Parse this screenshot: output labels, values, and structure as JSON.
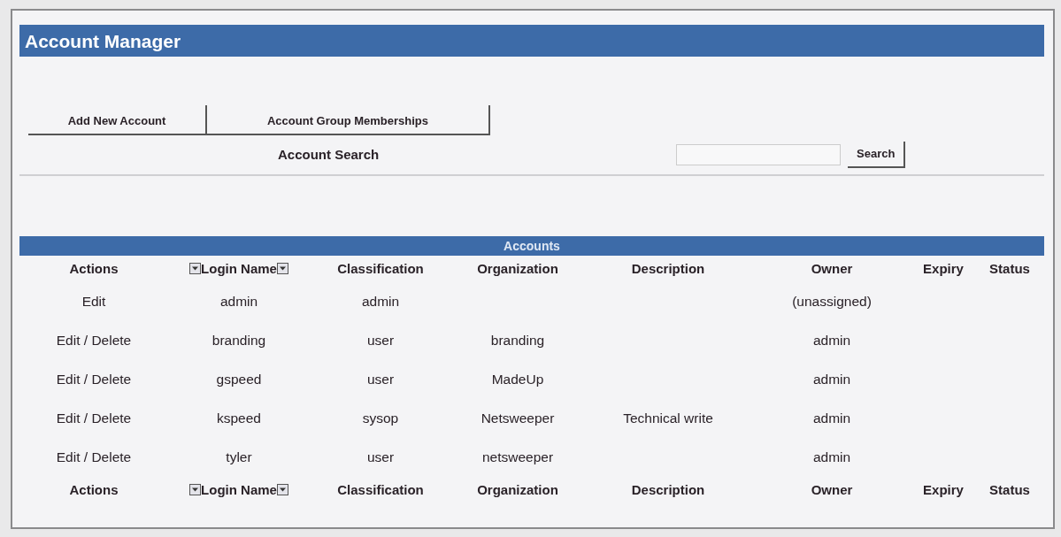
{
  "title": "Account Manager",
  "tabs": [
    {
      "label": "Add New Account"
    },
    {
      "label": "Account Group Memberships"
    }
  ],
  "search": {
    "label": "Account Search",
    "button": "Search"
  },
  "accounts": {
    "title": "Accounts",
    "columns": [
      {
        "label": "Actions",
        "sortable": false
      },
      {
        "label": "Login Name",
        "sortable": true
      },
      {
        "label": "Classification",
        "sortable": false
      },
      {
        "label": "Organization",
        "sortable": false
      },
      {
        "label": "Description",
        "sortable": false
      },
      {
        "label": "Owner",
        "sortable": false
      },
      {
        "label": "Expiry",
        "sortable": false
      },
      {
        "label": "Status",
        "sortable": false
      }
    ],
    "rows": [
      {
        "actions": "Edit",
        "login_name": "admin",
        "classification": "admin",
        "owner": "(unassigned)"
      },
      {
        "actions": "Edit / Delete",
        "login_name": "branding",
        "classification": "user",
        "organization": "branding",
        "owner": "admin"
      },
      {
        "actions": "Edit / Delete",
        "login_name": "gspeed",
        "classification": "user",
        "organization": "MadeUp",
        "owner": "admin"
      },
      {
        "actions": "Edit / Delete",
        "login_name": "kspeed",
        "classification": "sysop",
        "organization": "Netsweeper",
        "description": "Technical write",
        "owner": "admin"
      },
      {
        "actions": "Edit / Delete",
        "login_name": "tyler",
        "classification": "user",
        "organization": "netsweeper",
        "owner": "admin"
      }
    ],
    "footer_columns": [
      {
        "label": "Actions",
        "sortable": false
      },
      {
        "label": "Login Name",
        "sortable": true
      },
      {
        "label": "Classification",
        "sortable": false
      },
      {
        "label": "Organization",
        "sortable": false
      },
      {
        "label": "Description",
        "sortable": false
      },
      {
        "label": "Owner",
        "sortable": false
      },
      {
        "label": "Expiry",
        "sortable": false
      },
      {
        "label": "Status",
        "sortable": false
      }
    ]
  }
}
